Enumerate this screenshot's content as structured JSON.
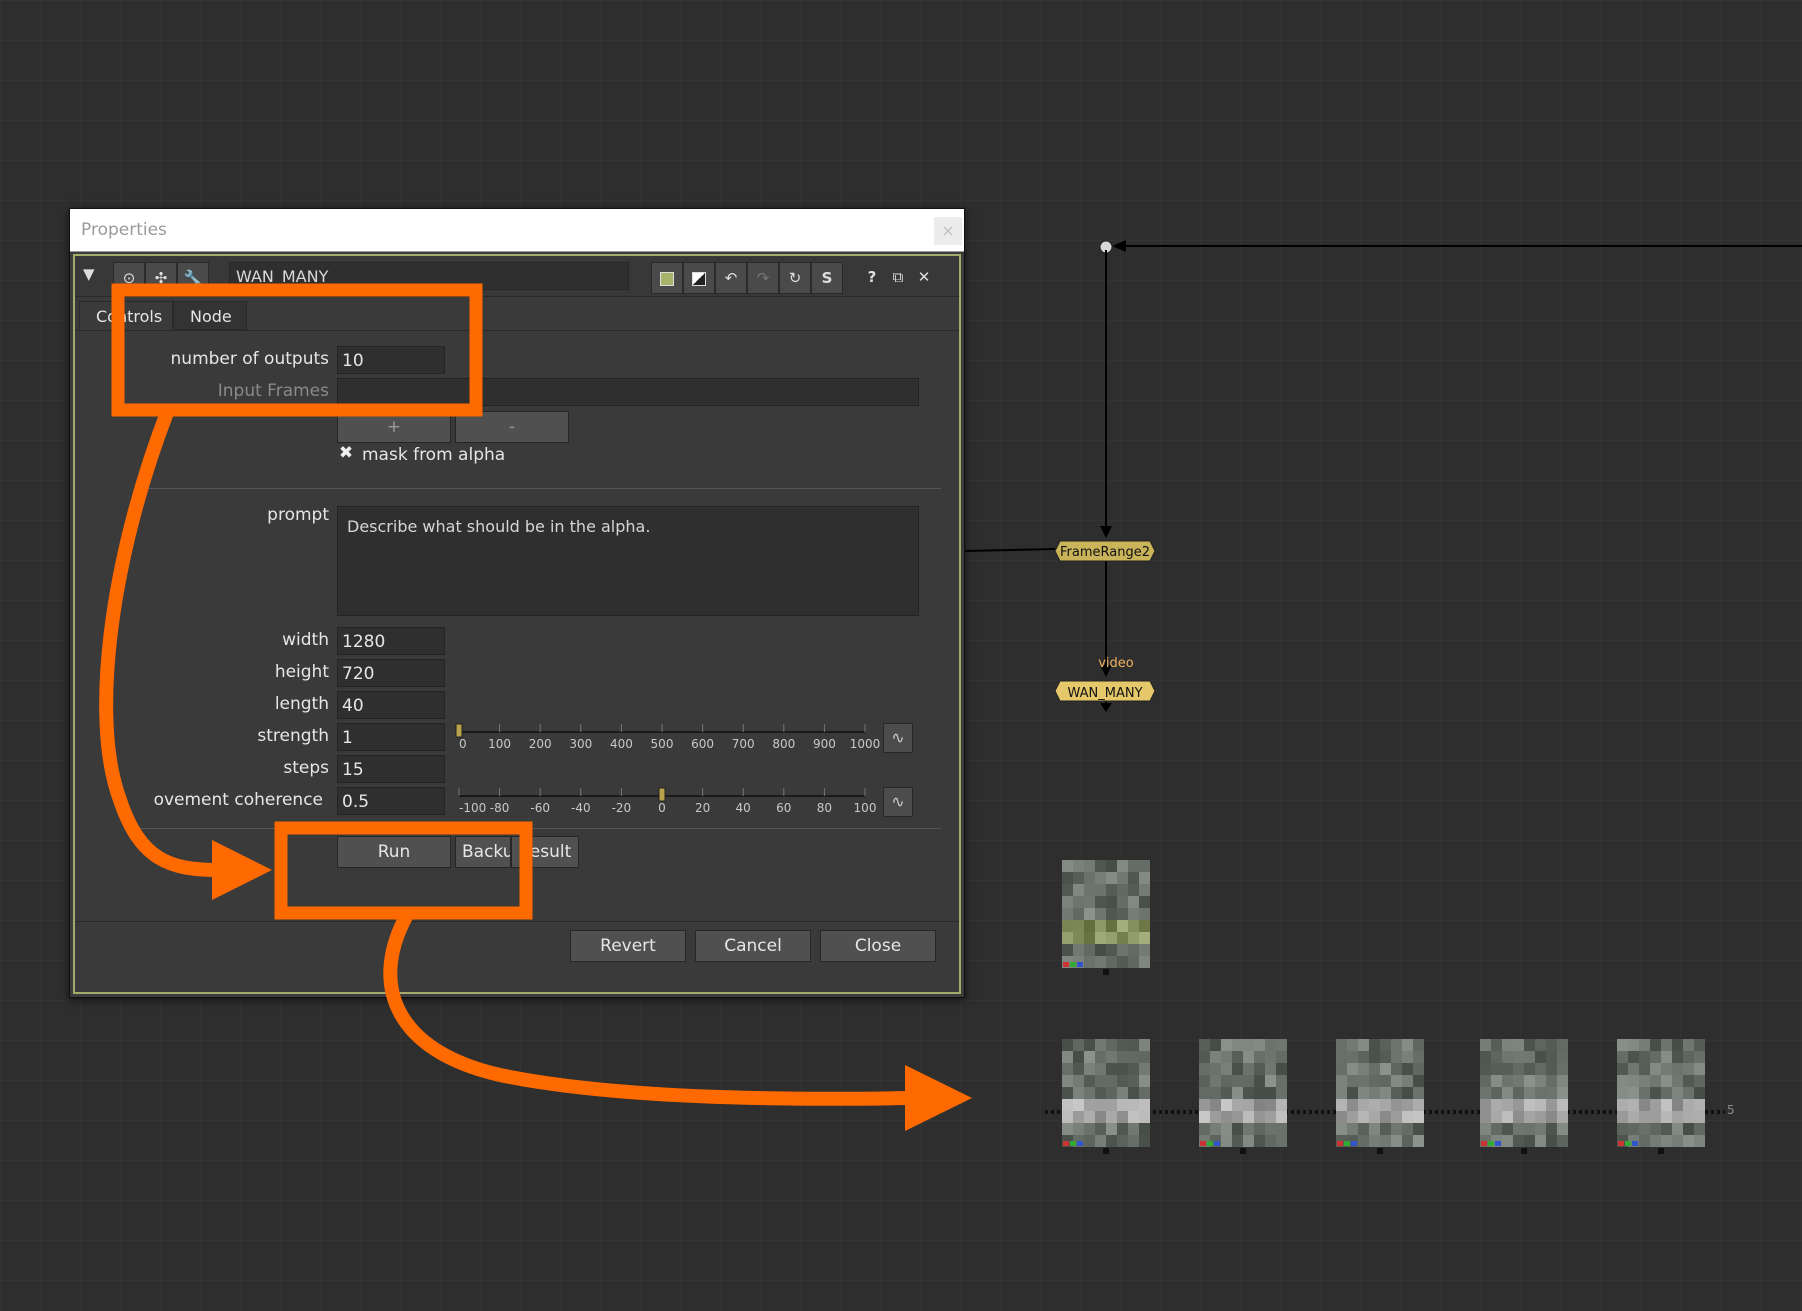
{
  "window": {
    "title": "Properties",
    "close_glyph": "×",
    "node_name": "WAN_MANY",
    "toolbar_icons": [
      "collapse-triangle-icon",
      "viewer-icon",
      "pin-icon",
      "wrench-icon",
      "color-swatch-icon",
      "alpha-swatch-icon",
      "undo-icon",
      "redo-icon",
      "revert-icon",
      "s-icon",
      "help-icon",
      "float-icon",
      "close-icon"
    ],
    "glyphs": {
      "tri": "▼",
      "help": "?",
      "float": "⧉",
      "close": "✕",
      "s": "S",
      "curve": "∿"
    }
  },
  "tabs": [
    {
      "label": "Controls",
      "active": true
    },
    {
      "label": "Node",
      "active": false
    }
  ],
  "controls": {
    "num_outputs_label": "number of outputs",
    "num_outputs_value": "10",
    "input_frames_label": "Input Frames",
    "input_frames_value": "",
    "plus_label": "+",
    "minus_label": "-",
    "checkbox_glyph": "✖",
    "mask_from_alpha_label": "mask from alpha",
    "mask_from_alpha_checked": true,
    "prompt_label": "prompt",
    "prompt_value": "Describe what should be in the alpha.",
    "width_label": "width",
    "width_value": "1280",
    "height_label": "height",
    "height_value": "720",
    "length_label": "length",
    "length_value": "40",
    "strength_label": "strength",
    "strength_value": "1",
    "strength_ticks": [
      "0",
      "100",
      "200",
      "300",
      "400",
      "500",
      "600",
      "700",
      "800",
      "900",
      "1000"
    ],
    "steps_label": "steps",
    "steps_value": "15",
    "coherence_label": "ovement coherence",
    "coherence_value": "0.5",
    "coherence_ticks": [
      "-100",
      "-80",
      "-60",
      "-40",
      "-20",
      "0",
      "20",
      "40",
      "60",
      "80",
      "100"
    ],
    "run_label": "Run",
    "backup_label": "Backu",
    "result_label": "Result"
  },
  "footer": {
    "revert_label": "Revert",
    "cancel_label": "Cancel",
    "close_label": "Close"
  },
  "graph": {
    "framerange_label": "FrameRange2",
    "video_pin_label": "video",
    "wan_many_label": "WAN_MANY",
    "node_color": "#c9b45a",
    "output_count_label": "5"
  },
  "annotation_color": "#ff6a00"
}
